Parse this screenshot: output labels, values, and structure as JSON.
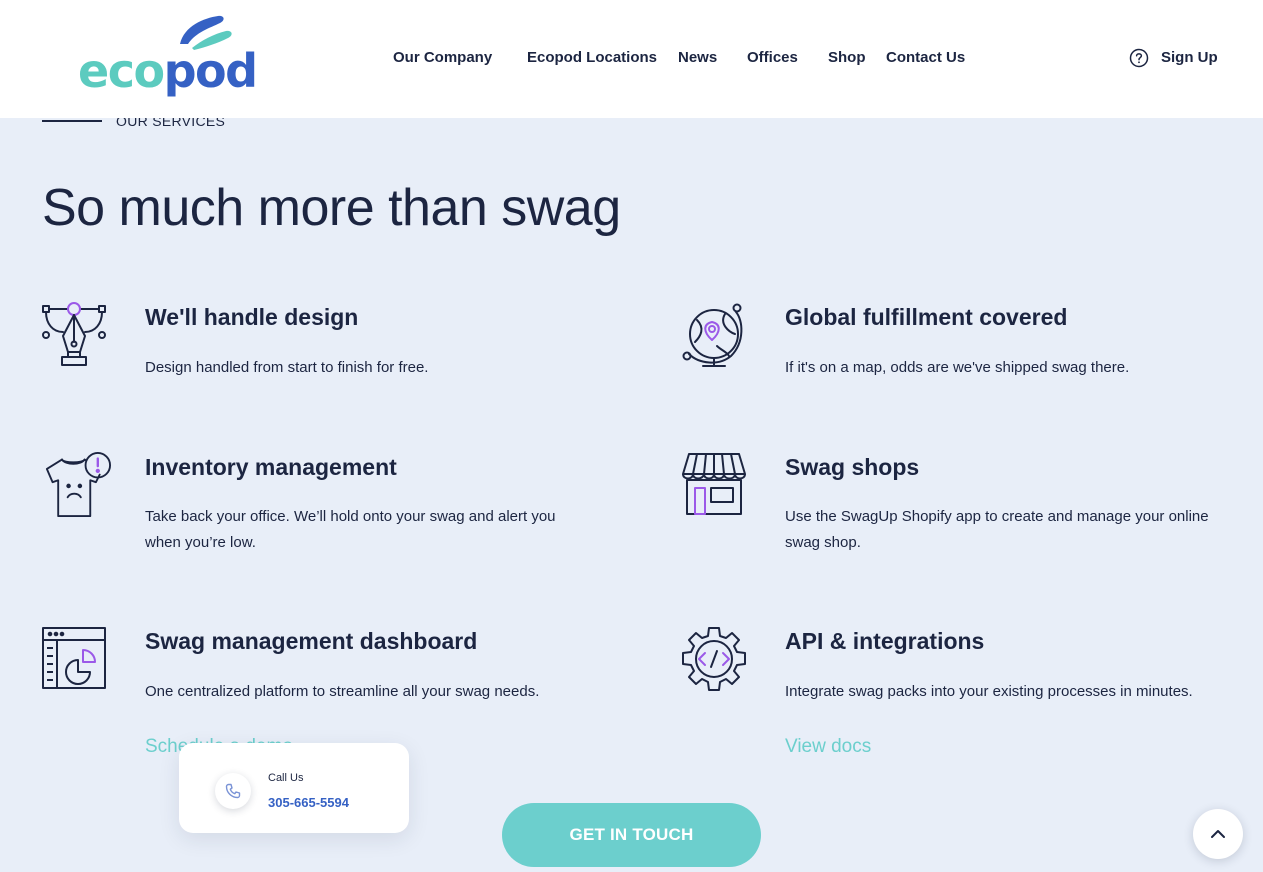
{
  "brand": {
    "logo_prefix": "eco",
    "logo_suffix": "pod"
  },
  "nav": {
    "items": [
      "Our Company",
      "Ecopod Locations",
      "News",
      "Offices",
      "Shop",
      "Contact Us"
    ],
    "signup_label": "Sign Up",
    "help_icon": "question-circle-icon"
  },
  "section": {
    "eyebrow": "OUR SERVICES",
    "title": "So much more than swag"
  },
  "services": [
    {
      "icon": "pen-tool-icon",
      "title": "We'll handle design",
      "desc": "Design handled from start to finish for free."
    },
    {
      "icon": "globe-pin-icon",
      "title": "Global fulfillment covered",
      "desc": "If it's on a map, odds are we've shipped swag there."
    },
    {
      "icon": "tshirt-alert-icon",
      "title": "Inventory management",
      "desc": "Take back your office. We’ll hold onto your swag and alert you when you’re low."
    },
    {
      "icon": "storefront-icon",
      "title": "Swag shops",
      "desc": "Use the SwagUp Shopify app to create and manage your online swag shop."
    },
    {
      "icon": "dashboard-chart-icon",
      "title": "Swag management dashboard",
      "desc": "One centralized platform to streamline all your swag needs.",
      "link": "Schedule a demo"
    },
    {
      "icon": "gear-code-icon",
      "title": "API & integrations",
      "desc": "Integrate swag packs into your existing processes in minutes.",
      "link": "View docs"
    }
  ],
  "call_card": {
    "label": "Call Us",
    "number": "305-665-5594",
    "icon": "phone-icon"
  },
  "cta_label": "GET IN TOUCH",
  "scroll_top_icon": "chevron-up-icon",
  "colors": {
    "navy": "#1c2541",
    "teal": "#6ccfcd",
    "blue": "#3561c4",
    "purple": "#9b59e8",
    "bg": "#e8eef8"
  }
}
